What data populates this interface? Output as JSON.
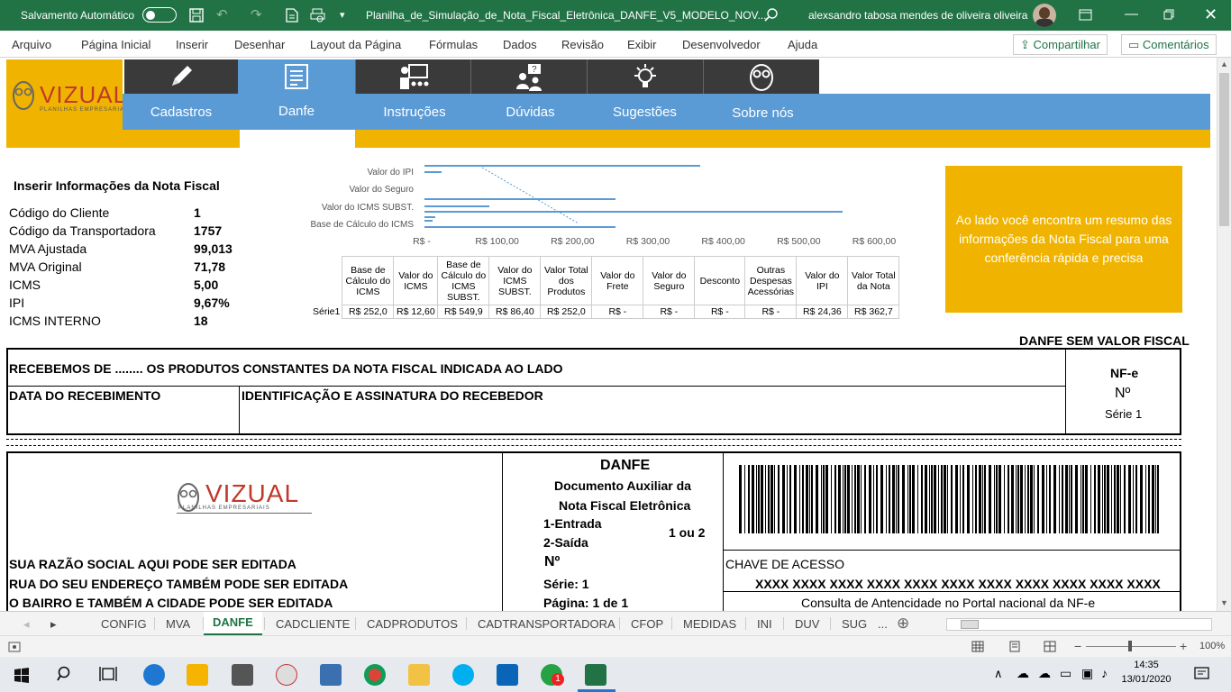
{
  "titlebar": {
    "autosave_label": "Salvamento Automático",
    "filename": "Planilha_de_Simulação_de_Nota_Fiscal_Eletrônica_DANFE_V5_MODELO_NOV...",
    "user": "alexsandro tabosa mendes de oliveira oliveira"
  },
  "menu": {
    "items": [
      "Arquivo",
      "Página Inicial",
      "Inserir",
      "Desenhar",
      "Layout da Página",
      "Fórmulas",
      "Dados",
      "Revisão",
      "Exibir",
      "Desenvolvedor",
      "Ajuda"
    ],
    "share": "Compartilhar",
    "comments": "Comentários"
  },
  "nav": {
    "items": [
      "Cadastros",
      "Danfe",
      "Instruções",
      "Dúvidas",
      "Sugestões",
      "Sobre nós"
    ],
    "logo": "VIZUAL",
    "logo_sub": "PLANILHAS EMPRESARIAIS"
  },
  "form": {
    "title": "Inserir Informações da Nota Fiscal",
    "rows": [
      {
        "label": "Código do Cliente",
        "value": "1"
      },
      {
        "label": "Código da Transportadora",
        "value": "1757"
      },
      {
        "label": "MVA Ajustada",
        "value": "99,013"
      },
      {
        "label": "MVA Original",
        "value": "71,78"
      },
      {
        "label": "ICMS",
        "value": "5,00"
      },
      {
        "label": "IPI",
        "value": "9,67%"
      },
      {
        "label": "ICMS INTERNO",
        "value": "18"
      }
    ]
  },
  "chart_data": {
    "type": "bar",
    "categories": [
      "Valor do IPI",
      "Valor do Seguro",
      "Valor do ICMS SUBST.",
      "Base de Cálculo do ICMS"
    ],
    "x_ticks": [
      "R$ -",
      "R$ 100,00",
      "R$ 200,00",
      "R$ 300,00",
      "R$ 400,00",
      "R$ 500,00",
      "R$ 600,00"
    ],
    "xlim": [
      0,
      600
    ]
  },
  "table": {
    "headers": [
      "Base de Cálculo do ICMS",
      "Valor do ICMS",
      "Base de Cálculo do ICMS SUBST.",
      "Valor do ICMS SUBST.",
      "Valor Total dos Produtos",
      "Valor do Frete",
      "Valor do Seguro",
      "Desconto",
      "Outras Despesas Acessórias",
      "Valor do IPI",
      "Valor Total da Nota"
    ],
    "row_label": "Série1",
    "values": [
      "R$ 252,0",
      "R$ 12,60",
      "R$ 549,9",
      "R$ 86,40",
      "R$ 252,0",
      "R$ -",
      "R$ -",
      "R$ -",
      "R$ -",
      "R$ 24,36",
      "R$ 362,7"
    ]
  },
  "info_box": "Ao lado você encontra um resumo das informações da Nota Fiscal para uma conferência rápida e precisa",
  "danfe": {
    "header": "DANFE SEM VALOR FISCAL",
    "recebemos": "RECEBEMOS DE ........ OS PRODUTOS CONSTANTES DA NOTA FISCAL INDICADA AO LADO",
    "data_receb": "DATA DO RECEBIMENTO",
    "ident": "IDENTIFICAÇÃO E ASSINATURA DO RECEBEDOR",
    "nfe": "NF-e",
    "numero": "Nº",
    "serie": "Série 1",
    "title": "DANFE",
    "doc1": "Documento Auxiliar da",
    "doc2": "Nota Fiscal Eletrônica",
    "entrada": "1-Entrada",
    "saida": "2-Saída",
    "ou": "1 ou 2",
    "num2": "Nº",
    "serie2": "Série: 1",
    "pagina": "Página:  1 de 1",
    "razao": "SUA RAZÃO SOCIAL AQUI PODE SER EDITADA",
    "rua": "RUA DO SEU ENDEREÇO TAMBÉM PODE SER EDITADA",
    "bairro": "O BAIRRO E TAMBÉM A CIDADE PODE SER EDITADA",
    "chave_label": "CHAVE DE ACESSO",
    "chave": "XXXX XXXX XXXX XXXX XXXX XXXX XXXX XXXX XXXX XXXX XXXX",
    "consulta": "Consulta de Antencidade no Portal nacional da NF-e"
  },
  "tabs": [
    "CONFIG",
    "MVA",
    "DANFE",
    "CADCLIENTE",
    "CADPRODUTOS",
    "CADTRANSPORTADORA",
    "CFOP",
    "MEDIDAS",
    "INI",
    "DUV",
    "SUG",
    "..."
  ],
  "active_tab": "DANFE",
  "status": {
    "zoom": "100%"
  },
  "taskbar": {
    "time": "14:35",
    "date": "13/01/2020"
  },
  "colors": {
    "excel_green": "#217346",
    "nav_blue": "#5b9bd5",
    "nav_dark": "#3a3a3a",
    "gold": "#f0b400"
  }
}
